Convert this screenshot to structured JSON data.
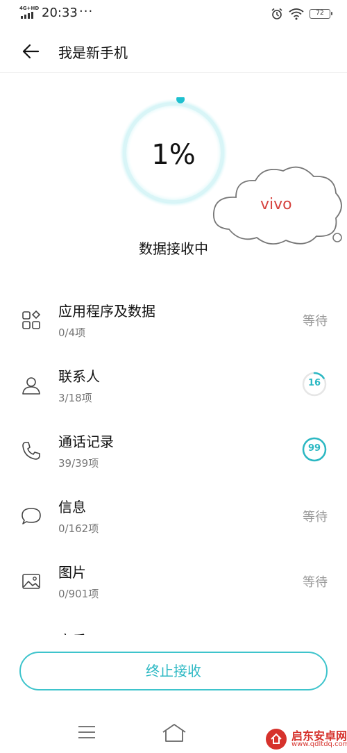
{
  "status_bar": {
    "network": "4G+HD",
    "time": "20:33",
    "dots": "···",
    "battery": "72",
    "icons": [
      "alarm-icon",
      "wifi-icon",
      "battery-icon"
    ]
  },
  "header": {
    "title": "我是新手机",
    "back_icon": "back-arrow-icon"
  },
  "progress": {
    "percent_text": "1%",
    "percent": 1,
    "status": "数据接收中"
  },
  "cloud": {
    "text": "vivo"
  },
  "items": [
    {
      "name": "应用程序及数据",
      "count": "0/4项",
      "state": "等待",
      "icon": "apps-icon"
    },
    {
      "name": "联系人",
      "count": "3/18项",
      "progress_text": "16",
      "progress": 0.16,
      "icon": "contact-icon"
    },
    {
      "name": "通话记录",
      "count": "39/39项",
      "progress_text": "99",
      "progress": 0.99,
      "icon": "phone-icon"
    },
    {
      "name": "信息",
      "count": "0/162项",
      "state": "等待",
      "icon": "message-icon"
    },
    {
      "name": "图片",
      "count": "0/901项",
      "state": "等待",
      "icon": "image-icon"
    },
    {
      "name": "音乐",
      "icon": "music-icon"
    }
  ],
  "stop_button": "终止接收",
  "nav": {
    "icons": [
      "menu-icon",
      "home-icon"
    ]
  },
  "watermark": {
    "title": "启东安卓网",
    "url": "www.qdltdq.com"
  },
  "colors": {
    "accent": "#2bb8c3",
    "cloud_text": "#d6433f",
    "watermark": "#d6322c"
  }
}
